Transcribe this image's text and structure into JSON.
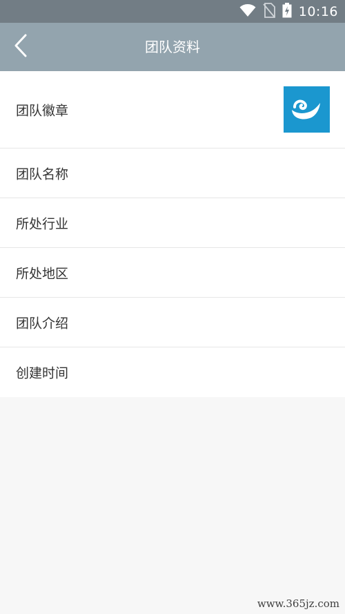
{
  "status_bar": {
    "time": "10:16",
    "icons": [
      "wifi-icon",
      "no-sim-icon",
      "battery-charging-icon"
    ]
  },
  "nav": {
    "title": "团队资料",
    "back_icon": "chevron-left-icon"
  },
  "rows": [
    {
      "label": "团队徽章",
      "has_image": true
    },
    {
      "label": "团队名称"
    },
    {
      "label": "所处行业"
    },
    {
      "label": "所处地区"
    },
    {
      "label": "团队介绍"
    },
    {
      "label": "创建时间"
    }
  ],
  "colors": {
    "status_bar": "#727d85",
    "nav_bar": "#93a4ae",
    "badge_bg": "#1b97cf",
    "page_bg": "#f7f7f7"
  },
  "watermark": "www.365jz.com"
}
